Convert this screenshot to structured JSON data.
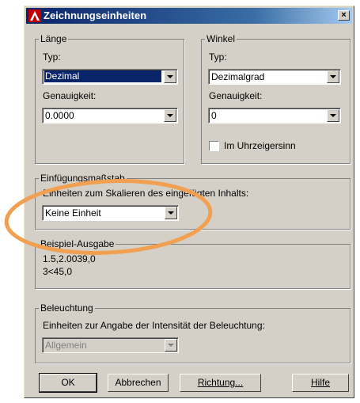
{
  "dialog": {
    "title": "Zeichnungseinheiten",
    "close_symbol": "×",
    "icon": "autocad-app-icon"
  },
  "length": {
    "legend": "Länge",
    "type_label": "Typ:",
    "type_value": "Dezimal",
    "precision_label": "Genauigkeit:",
    "precision_value": "0.0000"
  },
  "angle": {
    "legend": "Winkel",
    "type_label": "Typ:",
    "type_value": "Dezimalgrad",
    "precision_label": "Genauigkeit:",
    "precision_value": "0",
    "clockwise_label": "Im Uhrzeigersinn",
    "clockwise_checked": false
  },
  "insertion": {
    "legend": "Einfügungsmaßstab",
    "description": "Einheiten zum Skalieren des eingefügten Inhalts:",
    "value": "Keine Einheit"
  },
  "sample": {
    "legend": "Beispiel-Ausgabe",
    "line1": "1.5,2.0039,0",
    "line2": "3<45,0"
  },
  "lighting": {
    "legend": "Beleuchtung",
    "description": "Einheiten zur Angabe der Intensität der Beleuchtung:",
    "value": "Allgemein"
  },
  "buttons": {
    "ok": "OK",
    "cancel": "Abbrechen",
    "direction": "Richtung...",
    "help": "Hilfe"
  },
  "colors": {
    "dialog_bg": "#d4d0c8",
    "title_bar": "#0a246a",
    "selection": "#0a246a",
    "annotation_circle": "#f0a050"
  }
}
